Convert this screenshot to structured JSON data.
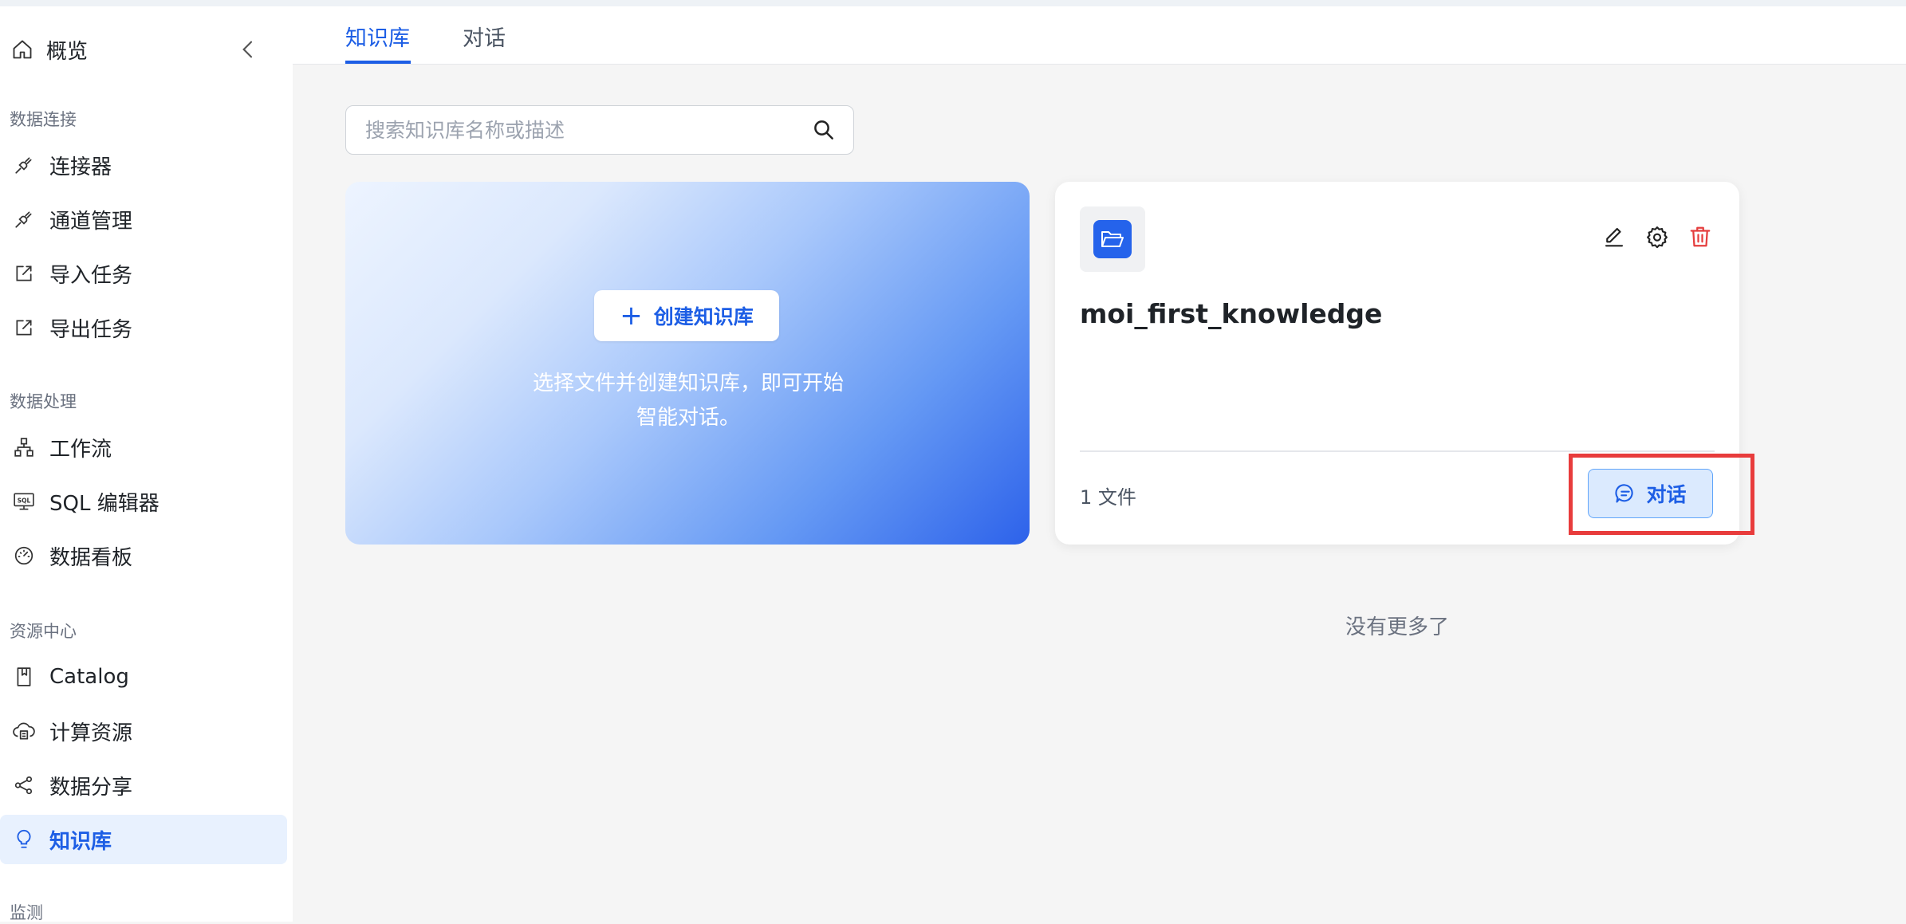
{
  "sidebar": {
    "overview": {
      "label": "概览"
    },
    "sections": [
      {
        "title": "数据连接",
        "items": [
          {
            "label": "连接器",
            "icon": "plug-icon"
          },
          {
            "label": "通道管理",
            "icon": "plug-icon"
          },
          {
            "label": "导入任务",
            "icon": "import-icon"
          },
          {
            "label": "导出任务",
            "icon": "export-icon"
          }
        ]
      },
      {
        "title": "数据处理",
        "items": [
          {
            "label": "工作流",
            "icon": "workflow-icon"
          },
          {
            "label": "SQL 编辑器",
            "icon": "sql-icon"
          },
          {
            "label": "数据看板",
            "icon": "dashboard-icon"
          }
        ]
      },
      {
        "title": "资源中心",
        "items": [
          {
            "label": "Catalog",
            "icon": "bookmark-icon"
          },
          {
            "label": "计算资源",
            "icon": "compute-icon"
          },
          {
            "label": "数据分享",
            "icon": "share-icon"
          },
          {
            "label": "知识库",
            "icon": "lightbulb-icon",
            "active": true
          }
        ]
      },
      {
        "title": "监测",
        "items": []
      }
    ]
  },
  "tabs": [
    {
      "label": "知识库",
      "active": true
    },
    {
      "label": "对话",
      "active": false
    }
  ],
  "search": {
    "placeholder": "搜索知识库名称或描述",
    "value": ""
  },
  "create_card": {
    "button_label": "创建知识库",
    "description_line1": "选择文件并创建知识库，即可开始",
    "description_line2": "智能对话。"
  },
  "kb_card": {
    "title": "moi_first_knowledge",
    "files": "1 文件",
    "chat_label": "对话"
  },
  "footer": {
    "no_more": "没有更多了"
  },
  "colors": {
    "accent": "#1d5ee5",
    "delete": "#e53e3e",
    "highlight": "#e83c3c",
    "active_bg": "#e8f1fe"
  }
}
